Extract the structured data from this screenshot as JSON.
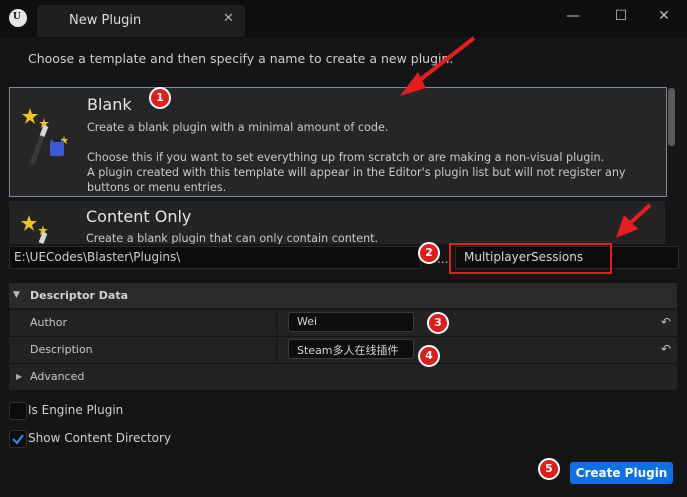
{
  "window": {
    "tab_title": "New Plugin",
    "tab_close_glyph": "✕",
    "minimize_glyph": "—",
    "maximize_glyph": "☐",
    "close_glyph": "✕"
  },
  "subtitle": "Choose a template and then specify a name to create a new plugin.",
  "templates": [
    {
      "name": "Blank",
      "icon": "magic-wand-icon",
      "description": "Create a blank plugin with a minimal amount of code.",
      "description_2": "Choose this if you want to set everything up from scratch or are making a non-visual plugin.",
      "description_3": "A plugin created with this template will appear in the Editor's plugin list but will not register any",
      "description_4": "buttons or menu entries.",
      "selected": true
    },
    {
      "name": "Content Only",
      "icon": "magic-wand-icon",
      "description": "Create a blank plugin that can only contain content.",
      "selected": false
    }
  ],
  "path": {
    "value": "E:\\UECodes\\Blaster\\Plugins\\",
    "browse_label": "..."
  },
  "plugin_name": {
    "value": "MultiplayerSessions"
  },
  "descriptor": {
    "header": "Descriptor Data",
    "author_label": "Author",
    "author_value": "Wei",
    "description_label": "Description",
    "description_value": "Steam多人在线插件",
    "advanced_label": "Advanced"
  },
  "options": {
    "engine_plugin_label": "Is Engine Plugin",
    "engine_plugin_checked": false,
    "show_content_label": "Show Content Directory",
    "show_content_checked": true
  },
  "create_button": "Create Plugin",
  "annotations": {
    "b1": "1",
    "b2": "2",
    "b3": "3",
    "b4": "4",
    "b5": "5"
  },
  "colors": {
    "accent": "#0e70e6",
    "annotation_red": "#e21d1d",
    "selection_border": "#7a8aa8"
  }
}
